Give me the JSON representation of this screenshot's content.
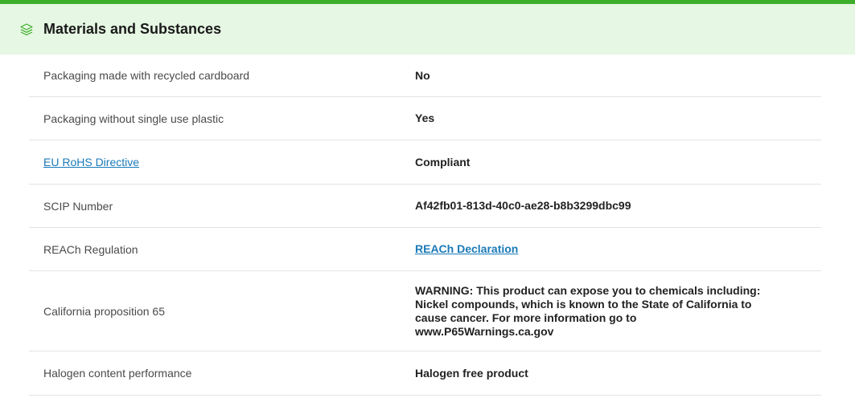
{
  "section": {
    "title": "Materials and Substances",
    "icon": "layers-icon",
    "accent_color": "#3dae2b",
    "header_bg": "#e6f7e3"
  },
  "rows": [
    {
      "label": "Packaging made with recycled cardboard",
      "value": "No"
    },
    {
      "label": "Packaging without single use plastic",
      "value": "Yes"
    },
    {
      "label": "EU RoHS Directive",
      "value": "Compliant"
    },
    {
      "label": "SCIP Number",
      "value": "Af42fb01-813d-40c0-ae28-b8b3299dbc99"
    },
    {
      "label": "REACh Regulation",
      "value": "REACh Declaration"
    },
    {
      "label": "California proposition 65",
      "value": "WARNING: This product can expose you to chemicals including: Nickel compounds, which is known to the State of California to cause cancer. For more information go to www.P65Warnings.ca.gov"
    },
    {
      "label": "Halogen content performance",
      "value": "Halogen free product"
    }
  ]
}
